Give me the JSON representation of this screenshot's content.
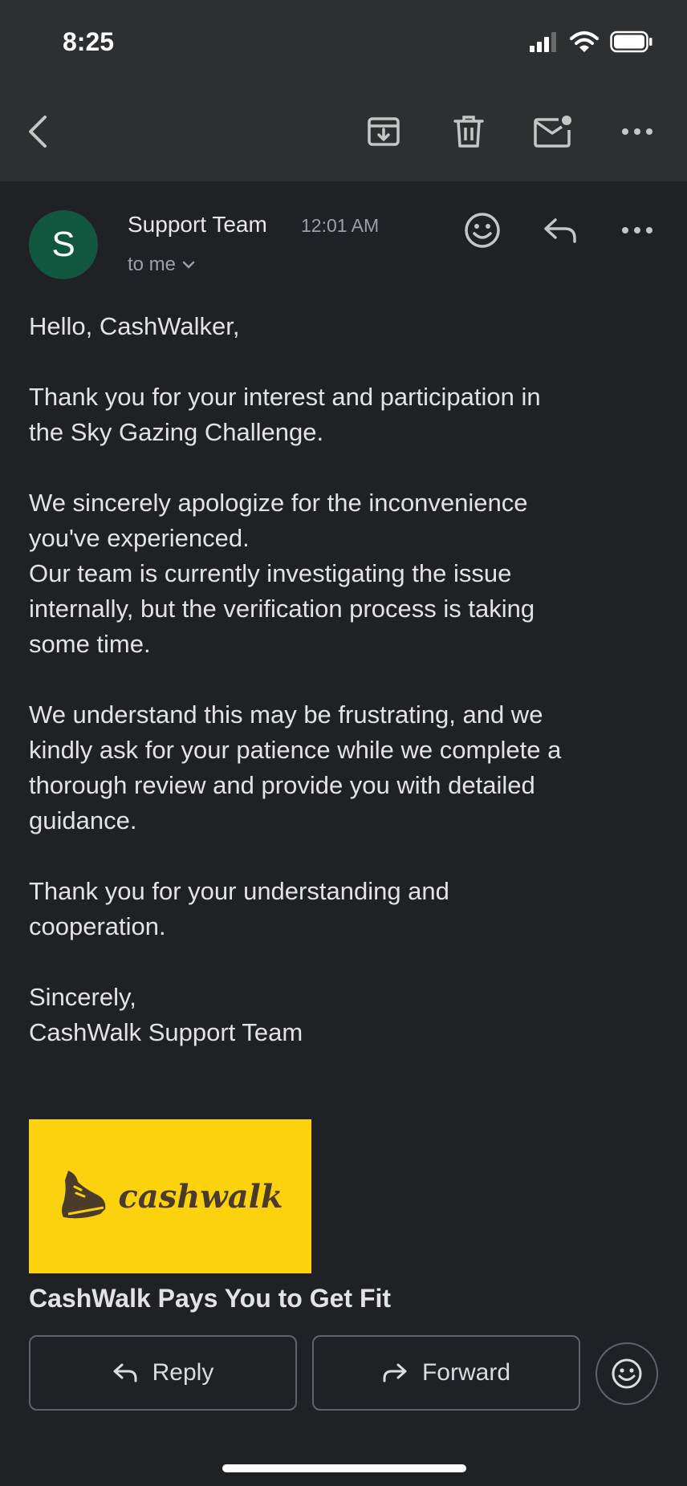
{
  "status_bar": {
    "time": "8:25"
  },
  "email": {
    "avatar_initial": "S",
    "sender": "Support Team",
    "time": "12:01 AM",
    "recipient": "to me",
    "body": [
      "Hello, CashWalker,",
      "Thank you for your interest and participation in\nthe Sky Gazing Challenge.",
      "We sincerely apologize for the inconvenience\nyou've experienced.\nOur team is currently investigating the issue\ninternally, but the verification process is taking\nsome time.",
      "We understand this may be frustrating, and we\nkindly ask for your patience while we complete a\nthorough review and provide you with detailed\nguidance.",
      "Thank you for your understanding and\ncooperation.",
      "Sincerely,\nCashWalk Support Team"
    ],
    "banner_logo_text": "cashwalk",
    "promo_title": "CashWalk Pays You to Get Fit"
  },
  "actions": {
    "reply_label": "Reply",
    "forward_label": "Forward"
  },
  "colors": {
    "background": "#202124",
    "toolbar": "#2e2f31",
    "avatar": "#115740",
    "banner": "#fcd20e"
  }
}
